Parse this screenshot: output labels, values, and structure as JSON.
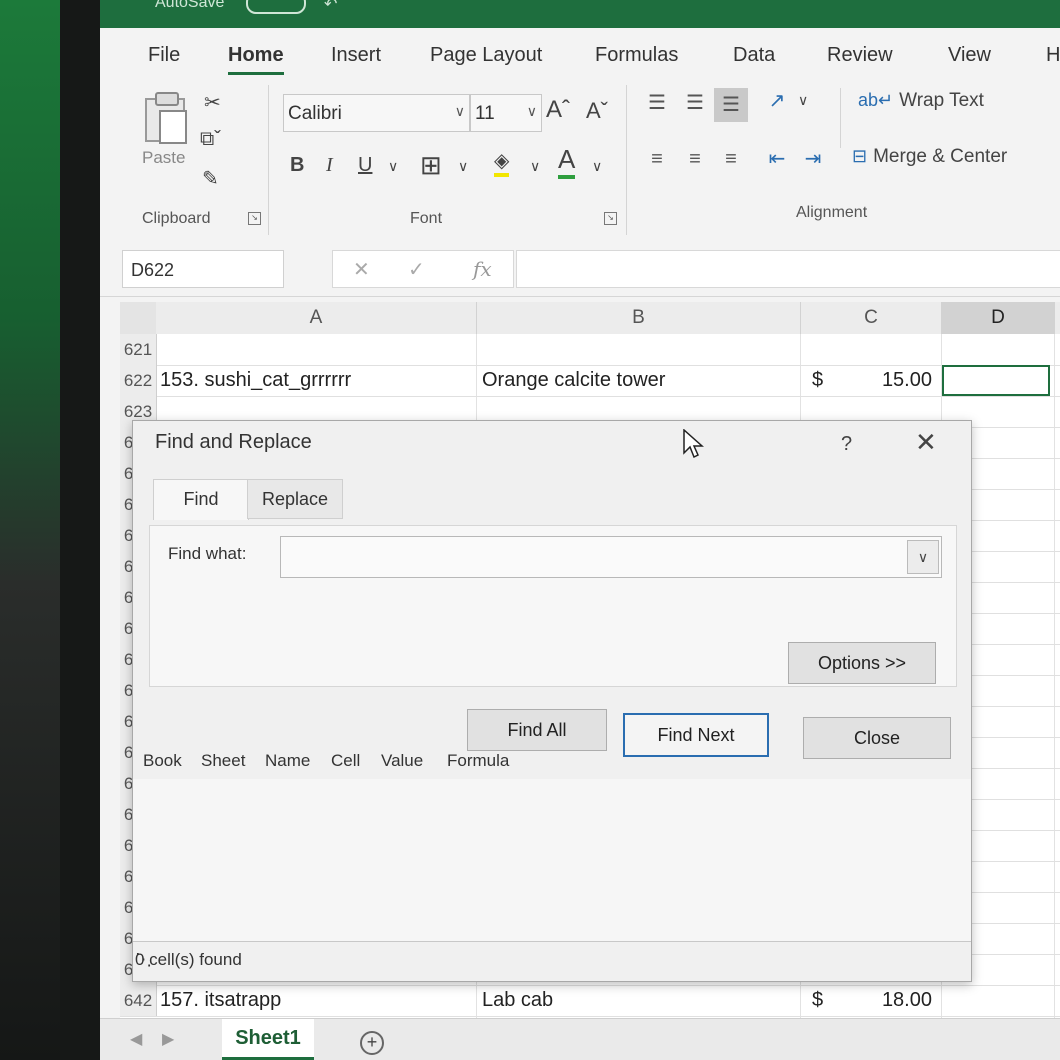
{
  "titlebar": {
    "autosave_label": "AutoSave",
    "autosave_state": "Off"
  },
  "ribbon_tabs": [
    "File",
    "Home",
    "Insert",
    "Page Layout",
    "Formulas",
    "Data",
    "Review",
    "View",
    "H"
  ],
  "active_tab": "Home",
  "clipboard": {
    "paste_label": "Paste",
    "group_label": "Clipboard"
  },
  "font": {
    "name": "Calibri",
    "size": "11",
    "group_label": "Font",
    "bold": "B",
    "italic": "I",
    "underline": "U",
    "grow": "Aˆ",
    "shrink": "Aˇ",
    "font_color": "A"
  },
  "alignment": {
    "wrap_text": "Wrap Text",
    "merge_center": "Merge & Center",
    "group_label": "Alignment"
  },
  "formula_bar": {
    "name_box": "D622",
    "fx": "fx",
    "value": ""
  },
  "columns": [
    "A",
    "B",
    "C",
    "D"
  ],
  "selected_column": "D",
  "rows": [
    {
      "num": "621",
      "a": "",
      "b": "",
      "c_sym": "",
      "c_val": ""
    },
    {
      "num": "622",
      "a": "153. sushi_cat_grrrrrr",
      "b": "Orange calcite tower",
      "c_sym": "$",
      "c_val": "15.00"
    },
    {
      "num": "623"
    },
    {
      "num": "624"
    },
    {
      "num": "625"
    },
    {
      "num": "626"
    },
    {
      "num": "627"
    },
    {
      "num": "628"
    },
    {
      "num": "629"
    },
    {
      "num": "630"
    },
    {
      "num": "631"
    },
    {
      "num": "632"
    },
    {
      "num": "633"
    },
    {
      "num": "634"
    },
    {
      "num": "635"
    },
    {
      "num": "636"
    },
    {
      "num": "637"
    },
    {
      "num": "638"
    },
    {
      "num": "639"
    },
    {
      "num": "640"
    },
    {
      "num": "641"
    },
    {
      "num": "642",
      "a": "157. itsatrapp",
      "b": "Lab cab",
      "c_sym": "$",
      "c_val": "18.00"
    }
  ],
  "sheet_tab": "Sheet1",
  "add_sheet": "+",
  "dialog": {
    "title": "Find and Replace",
    "help": "?",
    "tabs": [
      "Find",
      "Replace"
    ],
    "find_label": "Find what:",
    "find_value": "",
    "options_button": "Options >>",
    "find_all_button": "Find All",
    "find_next_button": "Find Next",
    "close_button": "Close",
    "result_columns": [
      "Book",
      "Sheet",
      "Name",
      "Cell",
      "Value",
      "Formula"
    ],
    "status": "0 cell(s) found"
  }
}
